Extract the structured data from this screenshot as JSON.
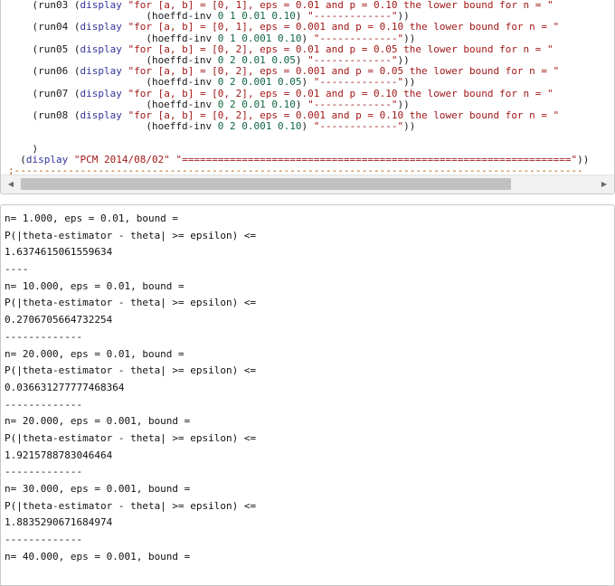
{
  "code_lines": [
    [
      [
        "plain",
        "    (run03 ("
      ],
      [
        "kw",
        "display"
      ],
      [
        "plain",
        " "
      ],
      [
        "str",
        "\"for [a, b] = [0, 1], eps = 0.01 and p = 0.10 the lower bound for n = \""
      ]
    ],
    [
      [
        "plain",
        "                       (hoeffd-inv "
      ],
      [
        "num",
        "0 1 0.01 0.10"
      ],
      [
        "plain",
        ") "
      ],
      [
        "str",
        "\"-------------\""
      ],
      [
        "plain",
        "))"
      ]
    ],
    [
      [
        "plain",
        "    (run04 ("
      ],
      [
        "kw",
        "display"
      ],
      [
        "plain",
        " "
      ],
      [
        "str",
        "\"for [a, b] = [0, 1], eps = 0.001 and p = 0.10 the lower bound for n = \""
      ]
    ],
    [
      [
        "plain",
        "                       (hoeffd-inv "
      ],
      [
        "num",
        "0 1 0.001 0.10"
      ],
      [
        "plain",
        ") "
      ],
      [
        "str",
        "\"-------------\""
      ],
      [
        "plain",
        "))"
      ]
    ],
    [
      [
        "plain",
        "    (run05 ("
      ],
      [
        "kw",
        "display"
      ],
      [
        "plain",
        " "
      ],
      [
        "str",
        "\"for [a, b] = [0, 2], eps = 0.01 and p = 0.05 the lower bound for n = \""
      ]
    ],
    [
      [
        "plain",
        "                       (hoeffd-inv "
      ],
      [
        "num",
        "0 2 0.01 0.05"
      ],
      [
        "plain",
        ") "
      ],
      [
        "str",
        "\"-------------\""
      ],
      [
        "plain",
        "))"
      ]
    ],
    [
      [
        "plain",
        "    (run06 ("
      ],
      [
        "kw",
        "display"
      ],
      [
        "plain",
        " "
      ],
      [
        "str",
        "\"for [a, b] = [0, 2], eps = 0.001 and p = 0.05 the lower bound for n = \""
      ]
    ],
    [
      [
        "plain",
        "                       (hoeffd-inv "
      ],
      [
        "num",
        "0 2 0.001 0.05"
      ],
      [
        "plain",
        ") "
      ],
      [
        "str",
        "\"-------------\""
      ],
      [
        "plain",
        "))"
      ]
    ],
    [
      [
        "plain",
        "    (run07 ("
      ],
      [
        "kw",
        "display"
      ],
      [
        "plain",
        " "
      ],
      [
        "str",
        "\"for [a, b] = [0, 2], eps = 0.01 and p = 0.10 the lower bound for n = \""
      ]
    ],
    [
      [
        "plain",
        "                       (hoeffd-inv "
      ],
      [
        "num",
        "0 2 0.01 0.10"
      ],
      [
        "plain",
        ") "
      ],
      [
        "str",
        "\"-------------\""
      ],
      [
        "plain",
        "))"
      ]
    ],
    [
      [
        "plain",
        "    (run08 ("
      ],
      [
        "kw",
        "display"
      ],
      [
        "plain",
        " "
      ],
      [
        "str",
        "\"for [a, b] = [0, 2], eps = 0.001 and p = 0.10 the lower bound for n = \""
      ]
    ],
    [
      [
        "plain",
        "                       (hoeffd-inv "
      ],
      [
        "num",
        "0 2 0.001 0.10"
      ],
      [
        "plain",
        ") "
      ],
      [
        "str",
        "\"-------------\""
      ],
      [
        "plain",
        "))"
      ]
    ],
    [
      [
        "plain",
        ""
      ]
    ],
    [
      [
        "plain",
        "    )"
      ]
    ],
    [
      [
        "plain",
        "  ("
      ],
      [
        "kw",
        "display"
      ],
      [
        "plain",
        " "
      ],
      [
        "str",
        "\"PCM 2014/08/02\""
      ],
      [
        "plain",
        " "
      ],
      [
        "str",
        "\"=================================================================\""
      ],
      [
        "plain",
        "))"
      ]
    ],
    [
      [
        "cmt",
        ";-----------------------------------------------------------------------------------------------"
      ]
    ]
  ],
  "scrollbar": {
    "left_arrow": "◀",
    "right_arrow": "▶"
  },
  "output_lines": [
    "n= 1.000, eps = 0.01, bound =",
    "P(|theta-estimator - theta| >= epsilon) <=",
    "1.6374615061559634",
    "----",
    "n= 10.000, eps = 0.01, bound =",
    "P(|theta-estimator - theta| >= epsilon) <=",
    "0.2706705664732254",
    "-------------",
    "n= 20.000, eps = 0.01, bound =",
    "P(|theta-estimator - theta| >= epsilon) <=",
    "0.036631277777468364",
    "-------------",
    "n= 20.000, eps = 0.001, bound =",
    "P(|theta-estimator - theta| >= epsilon) <=",
    "1.9215788783046464",
    "-------------",
    "n= 30.000, eps = 0.001, bound =",
    "P(|theta-estimator - theta| >= epsilon) <=",
    "1.8835290671684974",
    "-------------",
    "n= 40.000, eps = 0.001, bound ="
  ]
}
